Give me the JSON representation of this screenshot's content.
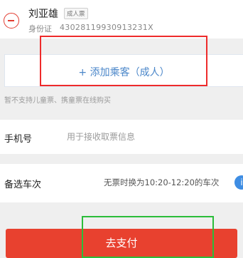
{
  "passenger": {
    "name": "刘亚雄",
    "ticket_type": "成人票",
    "id_label": "身份证",
    "id_number": "43028119930913231X"
  },
  "add_passenger": {
    "label": "+ 添加乘客（成人）"
  },
  "notice": "暂不支持儿童票、携童票在线购买",
  "phone": {
    "label": "手机号",
    "placeholder": "用于接收取票信息"
  },
  "alt_train": {
    "label": "备选车次",
    "value": "无票时换为10:20-12:20的车次"
  },
  "pay": {
    "label": "去支付"
  },
  "colors": {
    "accent_red": "#e8412f",
    "link_blue": "#4a86c9",
    "highlight_red": "#ee2b2b",
    "highlight_green": "#2bbd3a"
  }
}
